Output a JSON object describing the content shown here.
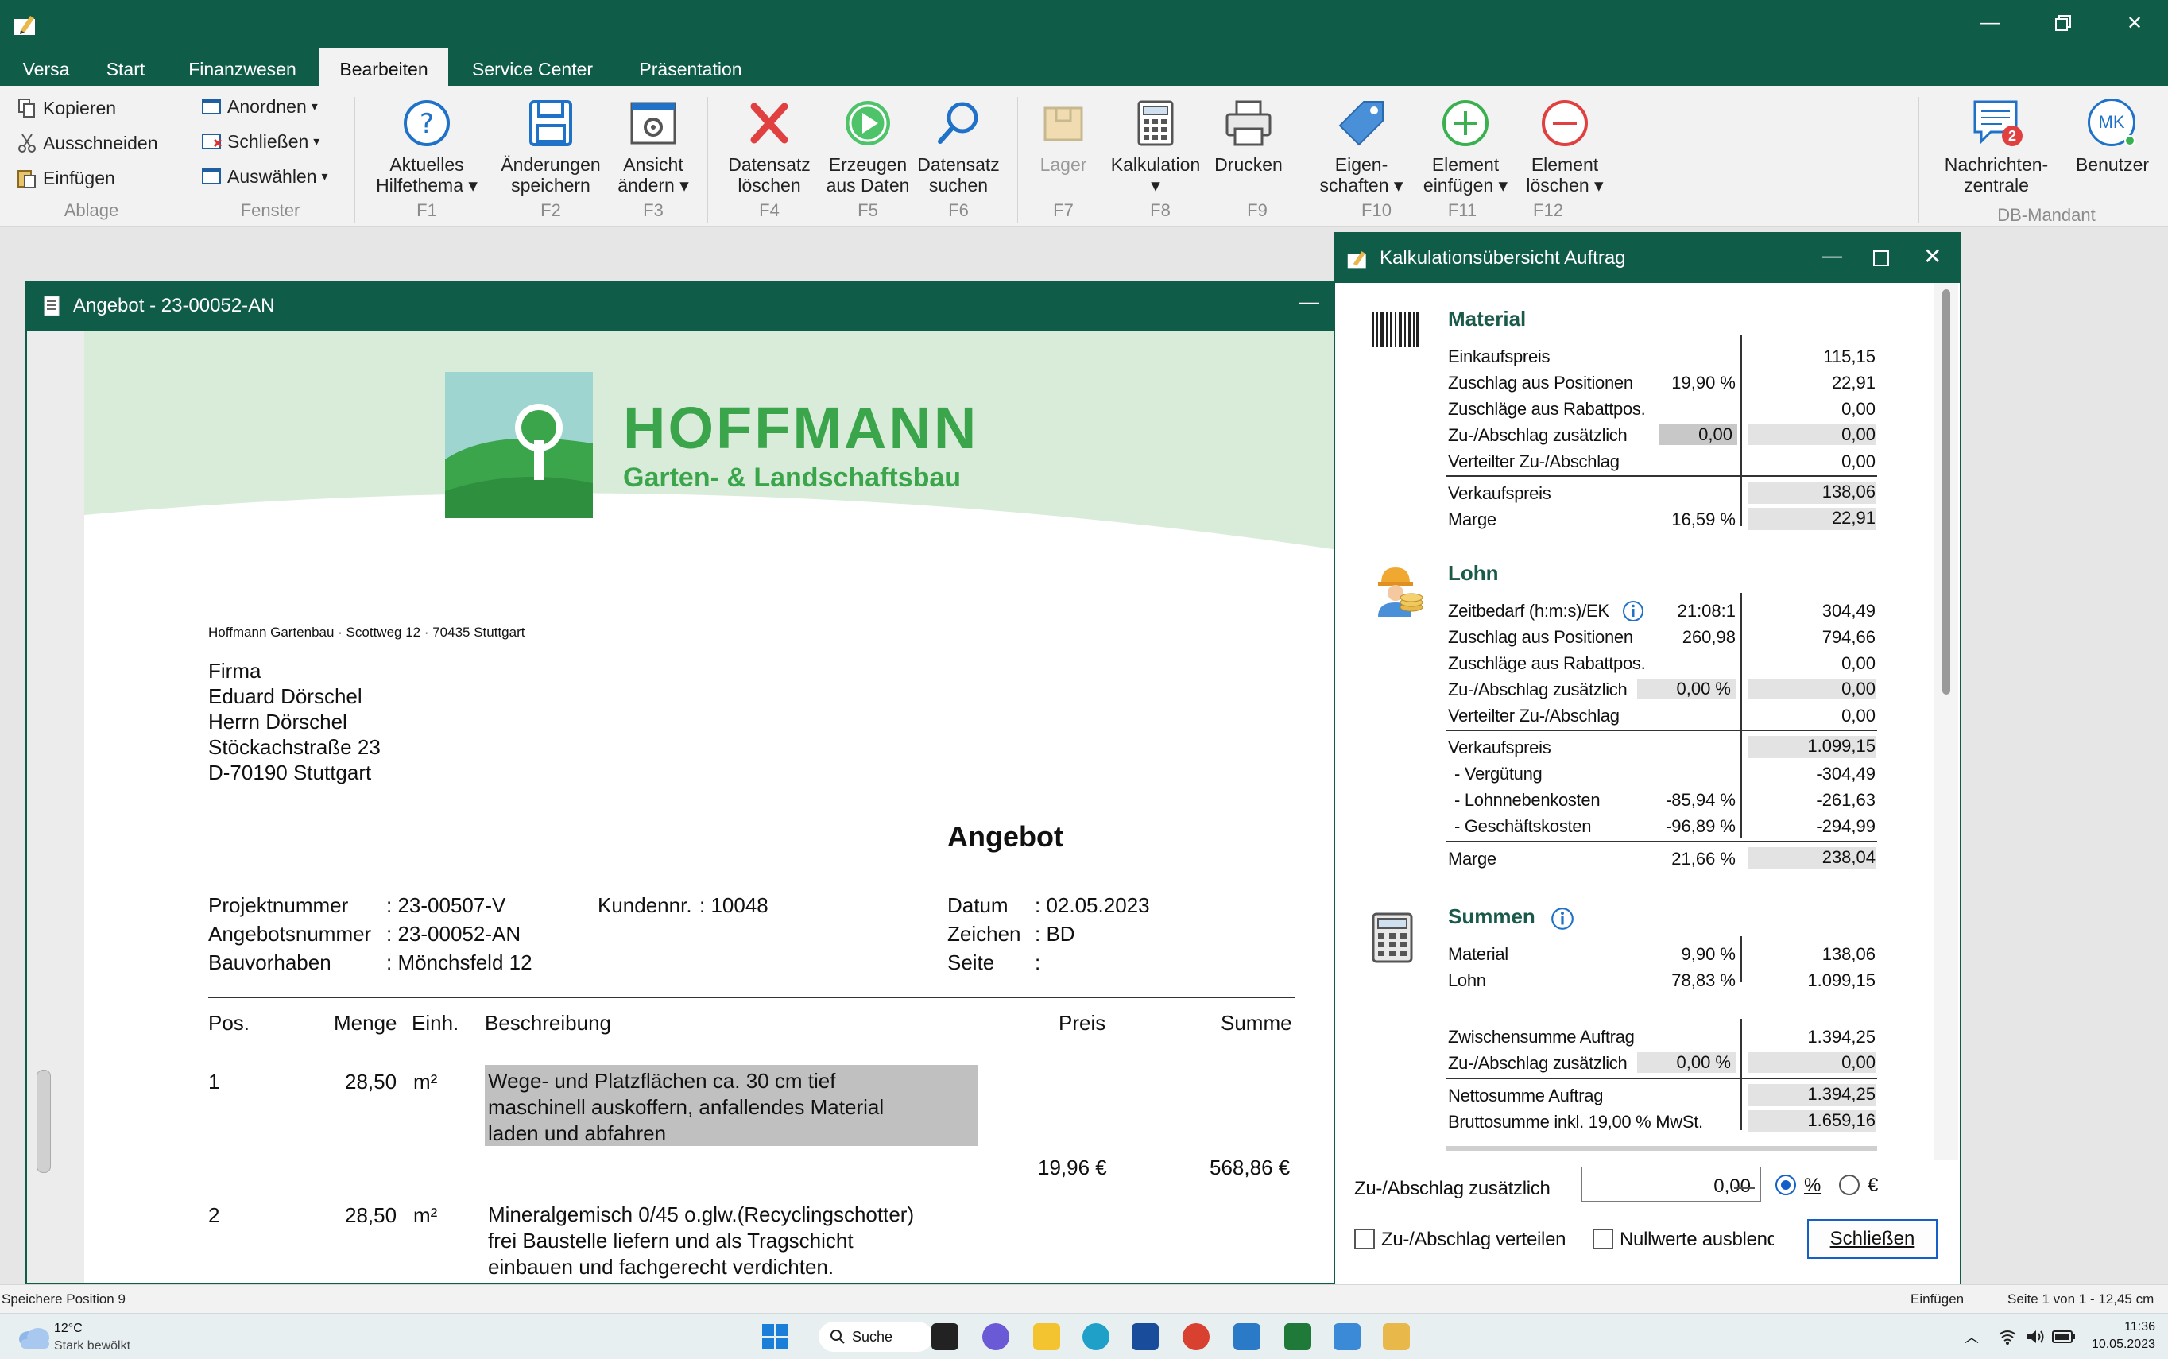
{
  "menu": {
    "tabs": [
      "Versa",
      "Start",
      "Finanzwesen",
      "Bearbeiten",
      "Service Center",
      "Präsentation"
    ]
  },
  "ribbon": {
    "ablage": {
      "kopieren": "Kopieren",
      "ausschneiden": "Ausschneiden",
      "einfuegen": "Einfügen",
      "label": "Ablage"
    },
    "fenster": {
      "anordnen": "Anordnen",
      "schliessen": "Schließen",
      "auswaehlen": "Auswählen",
      "label": "Fenster"
    },
    "buttons": [
      {
        "l1": "Aktuelles",
        "l2": "Hilfethema ▾",
        "key": "F1"
      },
      {
        "l1": "Änderungen",
        "l2": "speichern",
        "key": "F2"
      },
      {
        "l1": "Ansicht",
        "l2": "ändern ▾",
        "key": "F3"
      },
      {
        "l1": "Datensatz",
        "l2": "löschen",
        "key": "F4"
      },
      {
        "l1": "Erzeugen",
        "l2": "aus Daten",
        "key": "F5"
      },
      {
        "l1": "Datensatz",
        "l2": "suchen",
        "key": "F6"
      },
      {
        "l1": "Lager",
        "l2": "",
        "key": "F7"
      },
      {
        "l1": "Kalkulation",
        "l2": "▾",
        "key": "F8"
      },
      {
        "l1": "Drucken",
        "l2": "",
        "key": "F9"
      },
      {
        "l1": "Eigen-",
        "l2": "schaften ▾",
        "key": "F10"
      },
      {
        "l1": "Element",
        "l2": "einfügen ▾",
        "key": "F11"
      },
      {
        "l1": "Element",
        "l2": "löschen ▾",
        "key": "F12"
      }
    ],
    "nachrichten": {
      "l1": "Nachrichten-",
      "l2": "zentrale",
      "badge": "2"
    },
    "benutzer": {
      "label": "Benutzer",
      "initials": "MK"
    },
    "db_mandant": "DB-Mandant"
  },
  "document": {
    "window_title": "Angebot - 23-00052-AN",
    "company": {
      "name": "HOFFMANN",
      "tagline": "Garten- & Landschaftsbau"
    },
    "sender_line": "Hoffmann Gartenbau · Scottweg 12 · 70435 Stuttgart",
    "address": [
      "Firma",
      "Eduard Dörschel",
      "Herrn Dörschel",
      "Stöckachstraße 23",
      "D-70190 Stuttgart"
    ],
    "title": "Angebot",
    "meta": {
      "projektnummer_label": "Projektnummer",
      "projektnummer": ": 23-00507-V",
      "angebotsnummer_label": "Angebotsnummer",
      "angebotsnummer": ": 23-00052-AN",
      "bauvorhaben_label": "Bauvorhaben",
      "bauvorhaben": ": Mönchsfeld 12",
      "kundennr_label": "Kundennr.",
      "kundennr": ": 10048",
      "datum_label": "Datum",
      "datum": ": 02.05.2023",
      "zeichen_label": "Zeichen",
      "zeichen": ": BD",
      "seite_label": "Seite",
      "seite": ":"
    },
    "columns": {
      "pos": "Pos.",
      "menge": "Menge",
      "einh": "Einh.",
      "beschreibung": "Beschreibung",
      "preis": "Preis",
      "summe": "Summe"
    },
    "items": [
      {
        "pos": "1",
        "menge": "28,50",
        "einh": "m²",
        "lines": [
          "Wege- und Platzflächen ca. 30 cm tief",
          "maschinell auskoffern, anfallendes Material",
          "laden und abfahren"
        ],
        "preis": "19,96 €",
        "summe": "568,86 €"
      },
      {
        "pos": "2",
        "menge": "28,50",
        "einh": "m²",
        "lines": [
          "Mineralgemisch 0/45 o.glw.(Recyclingschotter)",
          "frei Baustelle liefern und als Tragschicht",
          "einbauen und fachgerecht verdichten."
        ]
      }
    ]
  },
  "calc": {
    "window_title": "Kalkulationsübersicht Auftrag",
    "material": {
      "title": "Material",
      "einkaufspreis": "Einkaufspreis",
      "einkaufspreis_v": "115,15",
      "zuschlag_pos": "Zuschlag aus Positionen",
      "zuschlag_pos_pct": "19,90 %",
      "zuschlag_pos_v": "22,91",
      "zuschlaege_rabatt": "Zuschläge aus Rabattpos.",
      "zuschlaege_rabatt_v": "0,00",
      "zu_ab": "Zu-/Abschlag zusätzlich",
      "zu_ab_pct": "0,00",
      "zu_ab_v": "0,00",
      "verteilter": "Verteilter Zu-/Abschlag",
      "verteilter_v": "0,00",
      "vk": "Verkaufspreis",
      "vk_v": "138,06",
      "marge": "Marge",
      "marge_pct": "16,59 %",
      "marge_v": "22,91"
    },
    "lohn": {
      "title": "Lohn",
      "zeitbedarf": "Zeitbedarf (h:m:s)/EK",
      "zeitbedarf_t": "21:08:1",
      "zeitbedarf_v": "304,49",
      "zuschlag_pos": "Zuschlag aus Positionen",
      "zuschlag_pos_pct": "260,98",
      "zuschlag_pos_v": "794,66",
      "zuschlaege_rabatt": "Zuschläge aus Rabattpos.",
      "zuschlaege_rabatt_v": "0,00",
      "zu_ab": "Zu-/Abschlag zusätzlich",
      "zu_ab_pct": "0,00 %",
      "zu_ab_v": "0,00",
      "verteilter": "Verteilter Zu-/Abschlag",
      "verteilter_v": "0,00",
      "vk": "Verkaufspreis",
      "vk_v": "1.099,15",
      "verguetung": "- Vergütung",
      "verguetung_v": "-304,49",
      "lnk": "- Lohnnebenkosten",
      "lnk_pct": "-85,94 %",
      "lnk_v": "-261,63",
      "gk": "- Geschäftskosten",
      "gk_pct": "-96,89 %",
      "gk_v": "-294,99",
      "marge": "Marge",
      "marge_pct": "21,66 %",
      "marge_v": "238,04"
    },
    "summen": {
      "title": "Summen",
      "material": "Material",
      "material_pct": "9,90 %",
      "material_v": "138,06",
      "lohn": "Lohn",
      "lohn_pct": "78,83 %",
      "lohn_v": "1.099,15",
      "zwischensumme": "Zwischensumme Auftrag",
      "zwischensumme_v": "1.394,25",
      "zu_ab": "Zu-/Abschlag zusätzlich",
      "zu_ab_pct": "0,00 %",
      "zu_ab_v": "0,00",
      "netto": "Nettosumme Auftrag",
      "netto_v": "1.394,25",
      "brutto": "Bruttosumme inkl. 19,00 % MwSt.",
      "brutto_v": "1.659,16"
    },
    "footer": {
      "zu_ab_label": "Zu-/Abschlag zusätzlich",
      "zu_ab_value": "0,00",
      "radio_pct": "%",
      "radio_eur": "€",
      "chk_verteilen": "Zu-/Abschlag verteilen",
      "chk_nullwerte": "Nullwerte ausblende",
      "close": "Schließen"
    }
  },
  "status": {
    "left": "Speichere Position 9",
    "mode": "Einfügen",
    "page": "Seite 1 von 1 - 12,45 cm"
  },
  "taskbar": {
    "weather_temp": "12°C",
    "weather_desc": "Stark bewölkt",
    "search": "Suche",
    "time": "11:36",
    "date": "10.05.2023"
  },
  "colors": {
    "brand": "#0f5c48",
    "logo_green": "#3aa54a",
    "accent_blue": "#1560c8",
    "delete_red": "#e04040"
  }
}
